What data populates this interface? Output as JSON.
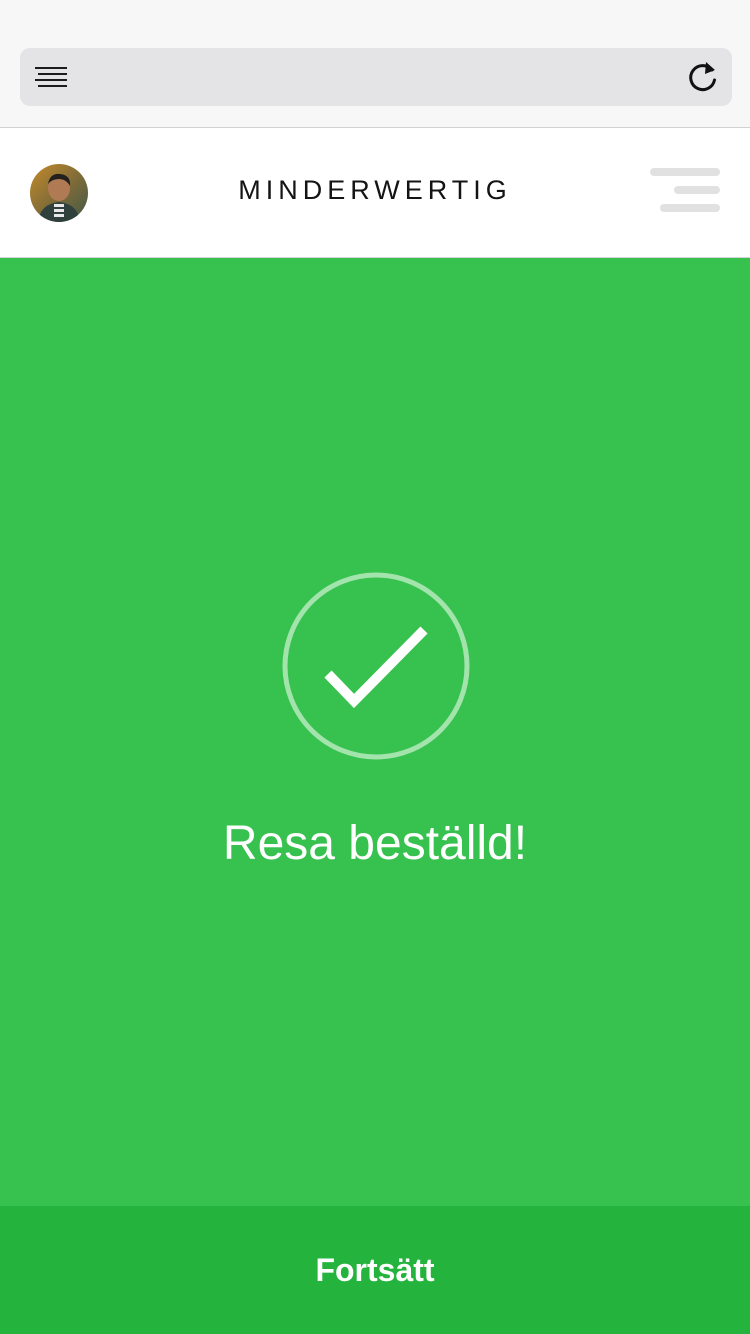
{
  "browser": {
    "reader_icon": "reader-lines-icon",
    "reload_icon": "reload-icon"
  },
  "header": {
    "brand": "MINDERWERTIG",
    "avatar_icon": "user-avatar",
    "menu_icon": "hamburger-menu-icon"
  },
  "confirmation": {
    "icon": "checkmark-circle-icon",
    "message": "Resa beställd!"
  },
  "footer": {
    "continue_label": "Fortsätt"
  },
  "colors": {
    "background": "#37c14e",
    "button": "#24b43d",
    "header": "#ffffff",
    "browser_chrome": "#f7f7f7"
  }
}
